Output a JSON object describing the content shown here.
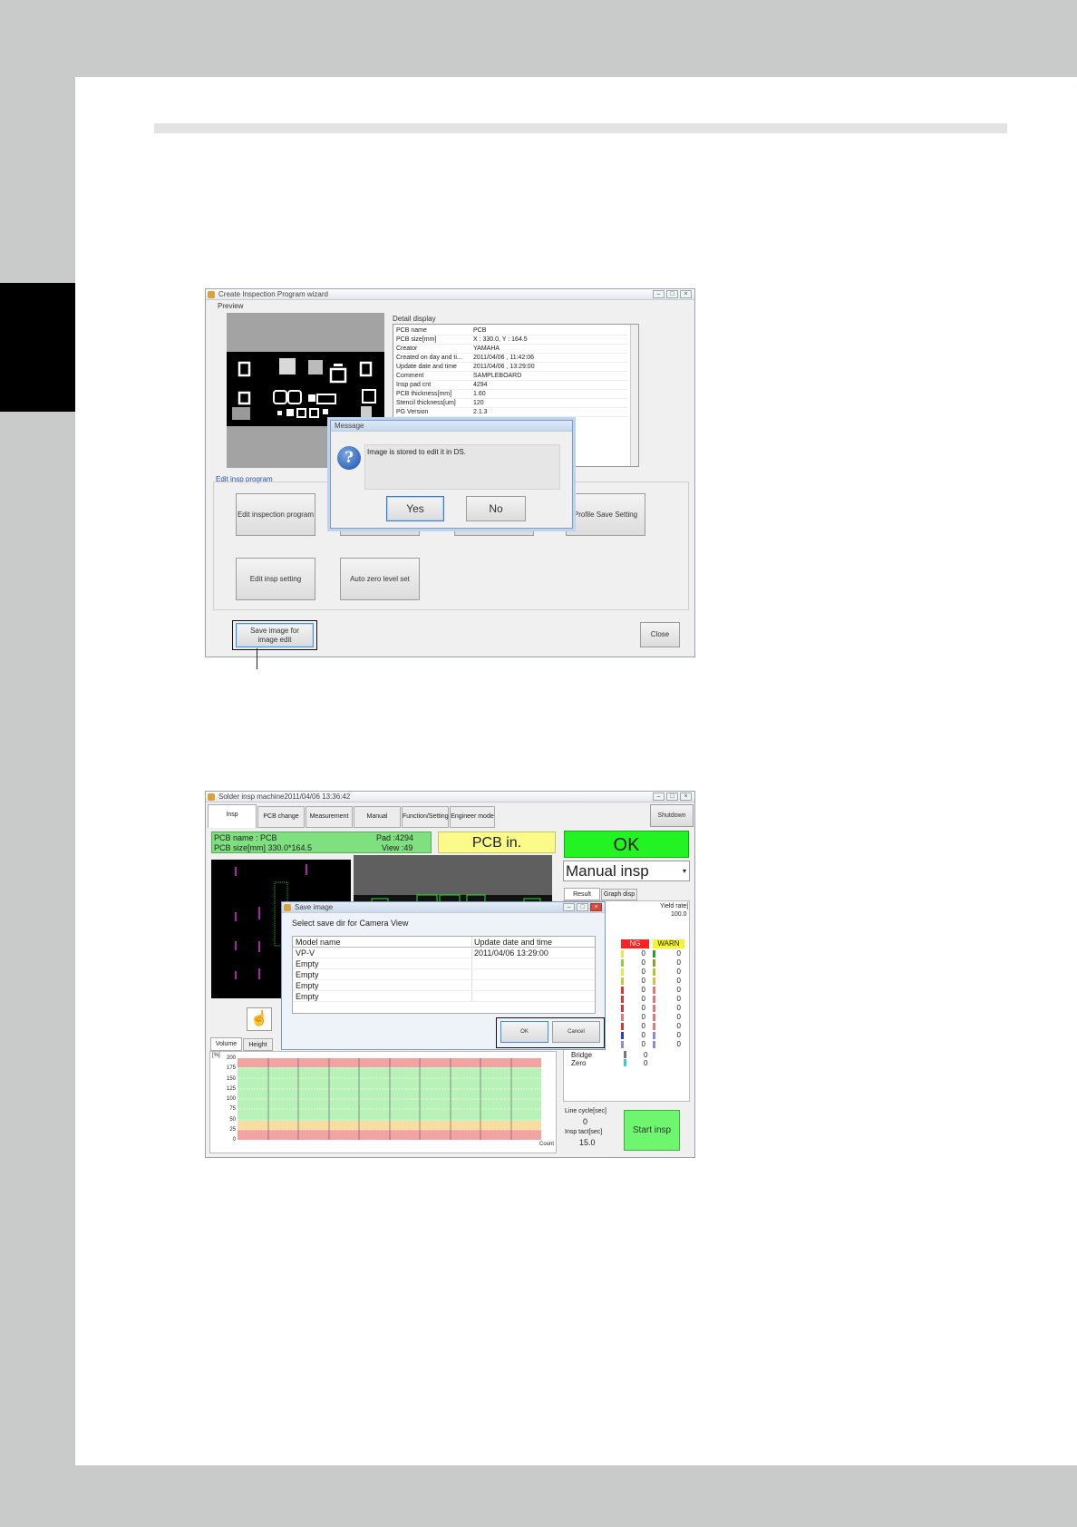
{
  "wizard": {
    "title": "Create Inspection Program wizard",
    "preview_label": "Preview",
    "detail_label": "Detail display",
    "details": [
      [
        "PCB name",
        "PCB"
      ],
      [
        "PCB size[mm]",
        "X : 330.0, Y : 164.5"
      ],
      [
        "Creator",
        "YAMAHA"
      ],
      [
        "Created on day and ti...",
        "2011/04/06 , 11:42:06"
      ],
      [
        "Update date and time",
        "2011/04/06 , 13:29:00"
      ],
      [
        "Comment",
        "SAMPLEBOARD"
      ],
      [
        "Insp pad cnt",
        "4294"
      ],
      [
        "PCB thickness[mm]",
        "1.60"
      ],
      [
        "Stencil thickness[um]",
        "120"
      ],
      [
        "PG Version",
        "2.1.3"
      ]
    ],
    "edit_label": "Edit insp program",
    "buttons": {
      "edit_program": "Edit inspection program",
      "profile_save": "Profile Save Setting",
      "edit_insp": "Edit insp setting",
      "auto_zero": "Auto zero level set",
      "save_image": "Save image for image edit",
      "close": "Close"
    },
    "message": {
      "title": "Message",
      "text": "Image is stored to edit it in DS.",
      "yes": "Yes",
      "no": "No"
    }
  },
  "machine": {
    "title": "Solder insp machine2011/04/06 13:36:42",
    "tabs": [
      "Insp",
      "PCB change",
      "Measurement",
      "Manual operation",
      "Function/Setting",
      "Engineer mode"
    ],
    "shutdown": "Shutdown",
    "pcb_name": "PCB name : PCB",
    "pad": "Pad :4294",
    "pcb_size": "PCB size[mm] 330.0*164.5",
    "view": "View :49",
    "status": "PCB in.",
    "result": "OK",
    "mode": "Manual insp",
    "result_tabs": [
      "Result",
      "Graph disp"
    ],
    "yield_label": "Yield rate[",
    "yield_value": "100.0",
    "ng_label": "NG",
    "warn_label": "WARN",
    "ng_values": [
      "0",
      "0",
      "0",
      "0",
      "0",
      "0",
      "0",
      "0",
      "0",
      "0",
      "0"
    ],
    "warn_values": [
      "0",
      "0",
      "0",
      "0",
      "0",
      "0",
      "0",
      "0",
      "0",
      "0",
      "0"
    ],
    "extra_labels": [
      "Bridge",
      "Zero"
    ],
    "extra_values": [
      "0",
      "0"
    ],
    "graph_tabs": [
      "Volume",
      "Height"
    ],
    "graph_ylabel": "[%]",
    "graph_yticks": [
      "200",
      "175",
      "150",
      "125",
      "100",
      "75",
      "50",
      "25",
      "0"
    ],
    "graph_xlabel": "Count",
    "line_cycle_label": "Line cycle[sec]",
    "line_cycle_value": "0",
    "insp_tact_label": "Insp tact[sec]",
    "insp_tact_value": "15.0",
    "start": "Start insp",
    "save": {
      "title": "Save image",
      "prompt": "Select save dir for Camera View",
      "col1": "Model name",
      "col2": "Update date and time",
      "rows": [
        [
          "VP-V",
          "2011/04/06 13:29:00"
        ],
        [
          "Empty",
          ""
        ],
        [
          "Empty",
          ""
        ],
        [
          "Empty",
          ""
        ],
        [
          "Empty",
          ""
        ]
      ],
      "ok": "OK",
      "cancel": "Cancel"
    }
  }
}
